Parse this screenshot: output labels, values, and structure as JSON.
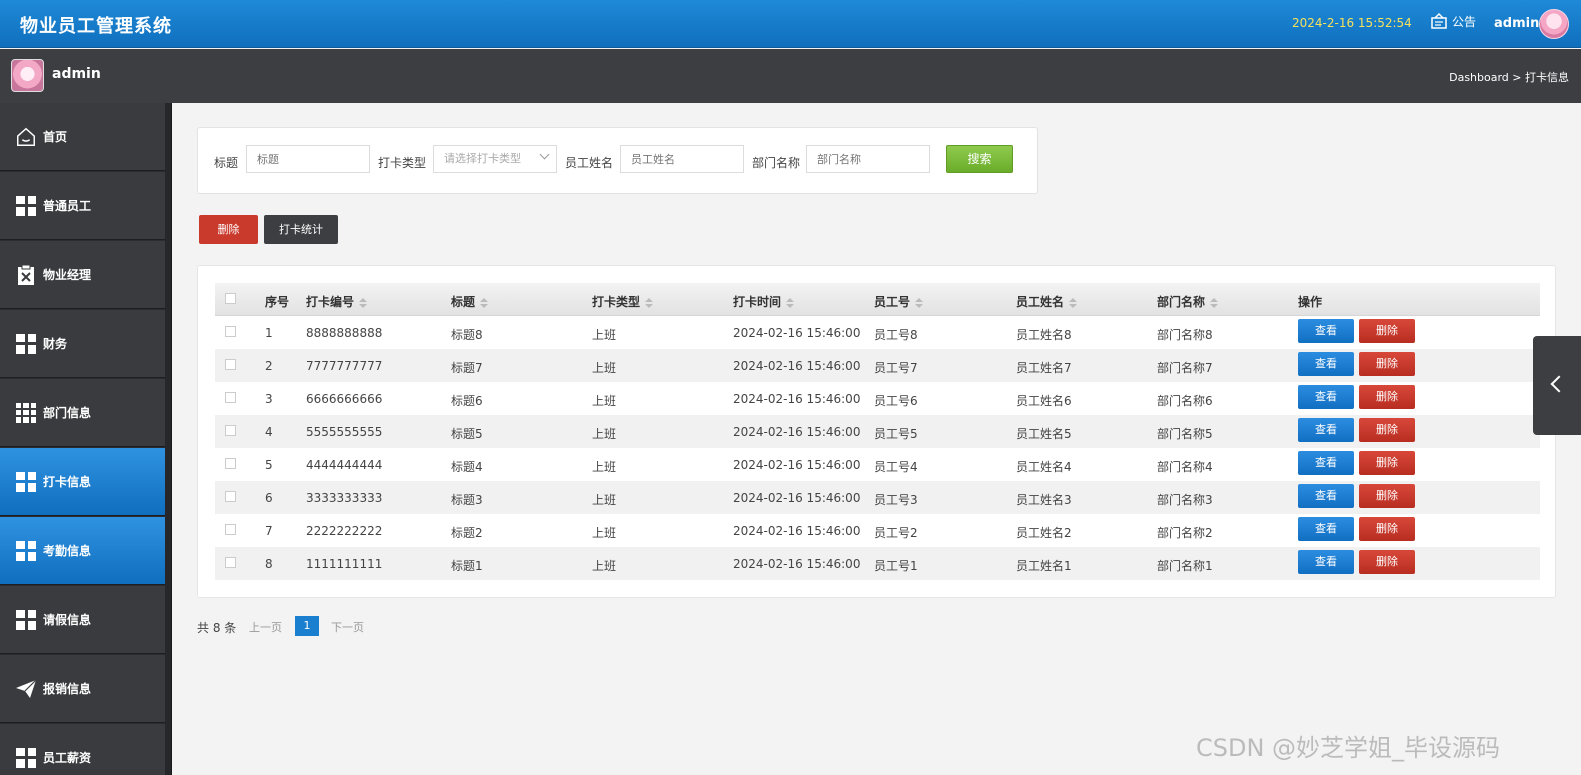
{
  "header": {
    "title": "物业员工管理系统",
    "datetime": "2024-2-16 15:52:54",
    "notice_label": "公告",
    "user": "admin"
  },
  "subbar": {
    "username": "admin",
    "breadcrumb": "Dashboard > 打卡信息"
  },
  "sidebar": {
    "items": [
      {
        "label": "首页",
        "icon": "home-icon"
      },
      {
        "label": "普通员工",
        "icon": "grid-icon"
      },
      {
        "label": "物业经理",
        "icon": "clipboard-icon"
      },
      {
        "label": "财务",
        "icon": "grid-icon"
      },
      {
        "label": "部门信息",
        "icon": "grid-nine-icon"
      },
      {
        "label": "打卡信息",
        "icon": "grid-icon",
        "active": true
      },
      {
        "label": "考勤信息",
        "icon": "grid-icon",
        "active": true
      },
      {
        "label": "请假信息",
        "icon": "grid-icon"
      },
      {
        "label": "报销信息",
        "icon": "paper-plane-icon"
      },
      {
        "label": "员工薪资",
        "icon": "grid-icon"
      }
    ]
  },
  "search": {
    "title_label": "标题",
    "title_placeholder": "标题",
    "type_label": "打卡类型",
    "type_placeholder": "请选择打卡类型",
    "name_label": "员工姓名",
    "name_placeholder": "员工姓名",
    "dept_label": "部门名称",
    "dept_placeholder": "部门名称",
    "search_button": "搜索"
  },
  "actions": {
    "delete": "删除",
    "stats": "打卡统计"
  },
  "table": {
    "headers": [
      "序号",
      "打卡编号",
      "标题",
      "打卡类型",
      "打卡时间",
      "员工号",
      "员工姓名",
      "部门名称",
      "操作"
    ],
    "view_label": "查看",
    "delete_label": "删除",
    "rows": [
      [
        "1",
        "8888888888",
        "标题8",
        "上班",
        "2024-02-16 15:46:00",
        "员工号8",
        "员工姓名8",
        "部门名称8"
      ],
      [
        "2",
        "7777777777",
        "标题7",
        "上班",
        "2024-02-16 15:46:00",
        "员工号7",
        "员工姓名7",
        "部门名称7"
      ],
      [
        "3",
        "6666666666",
        "标题6",
        "上班",
        "2024-02-16 15:46:00",
        "员工号6",
        "员工姓名6",
        "部门名称6"
      ],
      [
        "4",
        "5555555555",
        "标题5",
        "上班",
        "2024-02-16 15:46:00",
        "员工号5",
        "员工姓名5",
        "部门名称5"
      ],
      [
        "5",
        "4444444444",
        "标题4",
        "上班",
        "2024-02-16 15:46:00",
        "员工号4",
        "员工姓名4",
        "部门名称4"
      ],
      [
        "6",
        "3333333333",
        "标题3",
        "上班",
        "2024-02-16 15:46:00",
        "员工号3",
        "员工姓名3",
        "部门名称3"
      ],
      [
        "7",
        "2222222222",
        "标题2",
        "上班",
        "2024-02-16 15:46:00",
        "员工号2",
        "员工姓名2",
        "部门名称2"
      ],
      [
        "8",
        "1111111111",
        "标题1",
        "上班",
        "2024-02-16 15:46:00",
        "员工号1",
        "员工姓名1",
        "部门名称1"
      ]
    ]
  },
  "pagination": {
    "total": "共 8 条",
    "prev": "上一页",
    "current": "1",
    "next": "下一页"
  },
  "watermark": "CSDN @妙芝学姐_毕设源码"
}
